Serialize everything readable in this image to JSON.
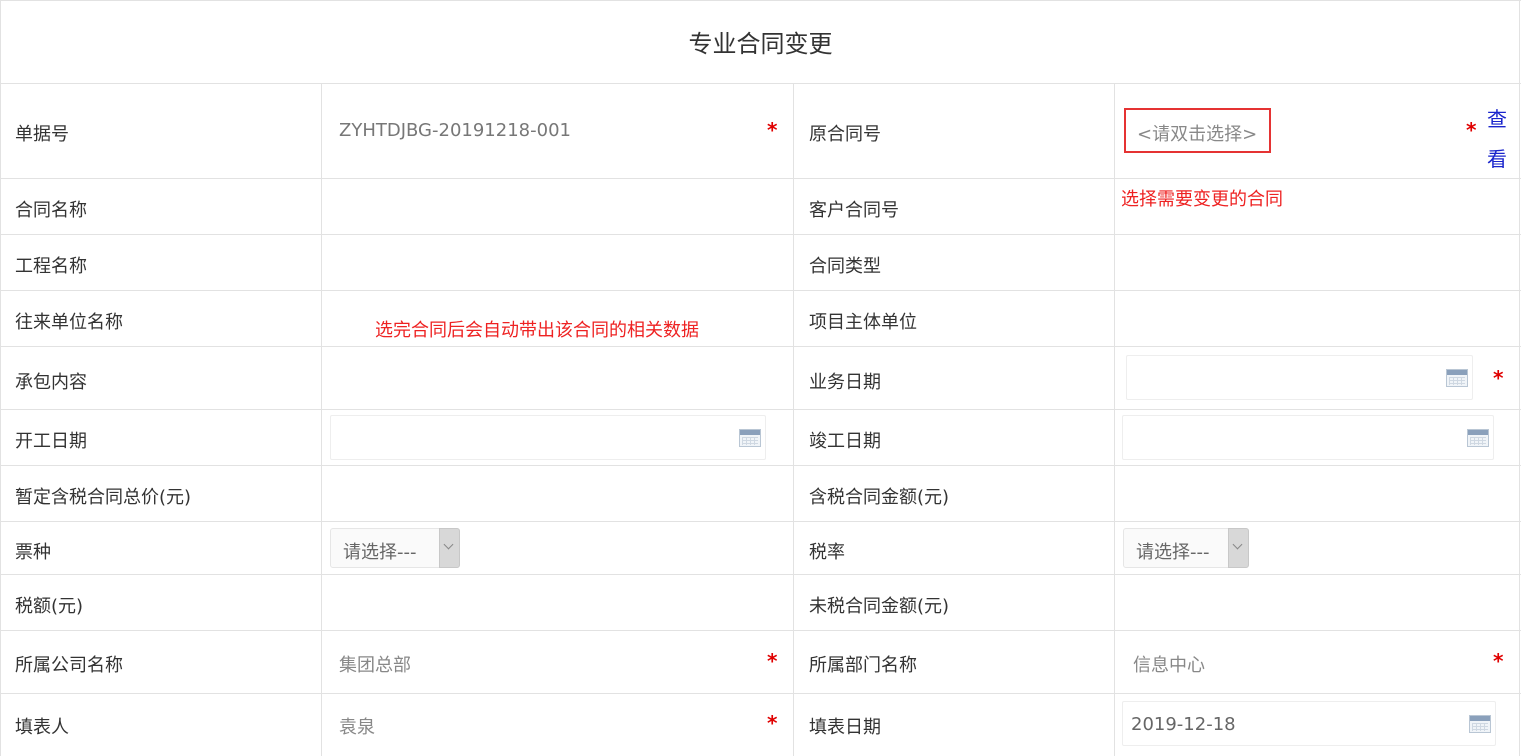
{
  "form": {
    "title": "专业合同变更",
    "annotations": {
      "select_contract": "选择需要变更的合同",
      "auto_fill": "选完合同后会自动带出该合同的相关数据"
    },
    "fields": {
      "doc_no": {
        "label": "单据号",
        "value": "ZYHTDJBG-20191218-001"
      },
      "orig_contract_no": {
        "label": "原合同号",
        "placeholder": "<请双击选择>",
        "view_link": "查看"
      },
      "contract_name": {
        "label": "合同名称",
        "value": ""
      },
      "customer_contract_no": {
        "label": "客户合同号",
        "value": ""
      },
      "project_name": {
        "label": "工程名称",
        "value": ""
      },
      "contract_type": {
        "label": "合同类型",
        "value": ""
      },
      "counterparty": {
        "label": "往来单位名称",
        "value": ""
      },
      "project_entity": {
        "label": "项目主体单位",
        "value": ""
      },
      "scope": {
        "label": "承包内容",
        "value": ""
      },
      "business_date": {
        "label": "业务日期",
        "value": ""
      },
      "start_date": {
        "label": "开工日期",
        "value": ""
      },
      "completion_date": {
        "label": "竣工日期",
        "value": ""
      },
      "provisional_total": {
        "label": "暂定含税合同总价(元)",
        "value": ""
      },
      "taxed_amount": {
        "label": "含税合同金额(元)",
        "value": ""
      },
      "invoice_type": {
        "label": "票种",
        "value": "请选择---"
      },
      "tax_rate": {
        "label": "税率",
        "value": "请选择---"
      },
      "tax_amount": {
        "label": "税额(元)",
        "value": ""
      },
      "untaxed_amount": {
        "label": "未税合同金额(元)",
        "value": ""
      },
      "company": {
        "label": "所属公司名称",
        "value": "集团总部"
      },
      "department": {
        "label": "所属部门名称",
        "value": "信息中心"
      },
      "preparer": {
        "label": "填表人",
        "value": "袁泉"
      },
      "fill_date": {
        "label": "填表日期",
        "value": "2019-12-18"
      }
    },
    "required_mark": "*",
    "colors": {
      "required": "#e00000",
      "annotation": "#ee2222",
      "link": "#1a25cc",
      "highlight_box": "#e53333"
    }
  }
}
